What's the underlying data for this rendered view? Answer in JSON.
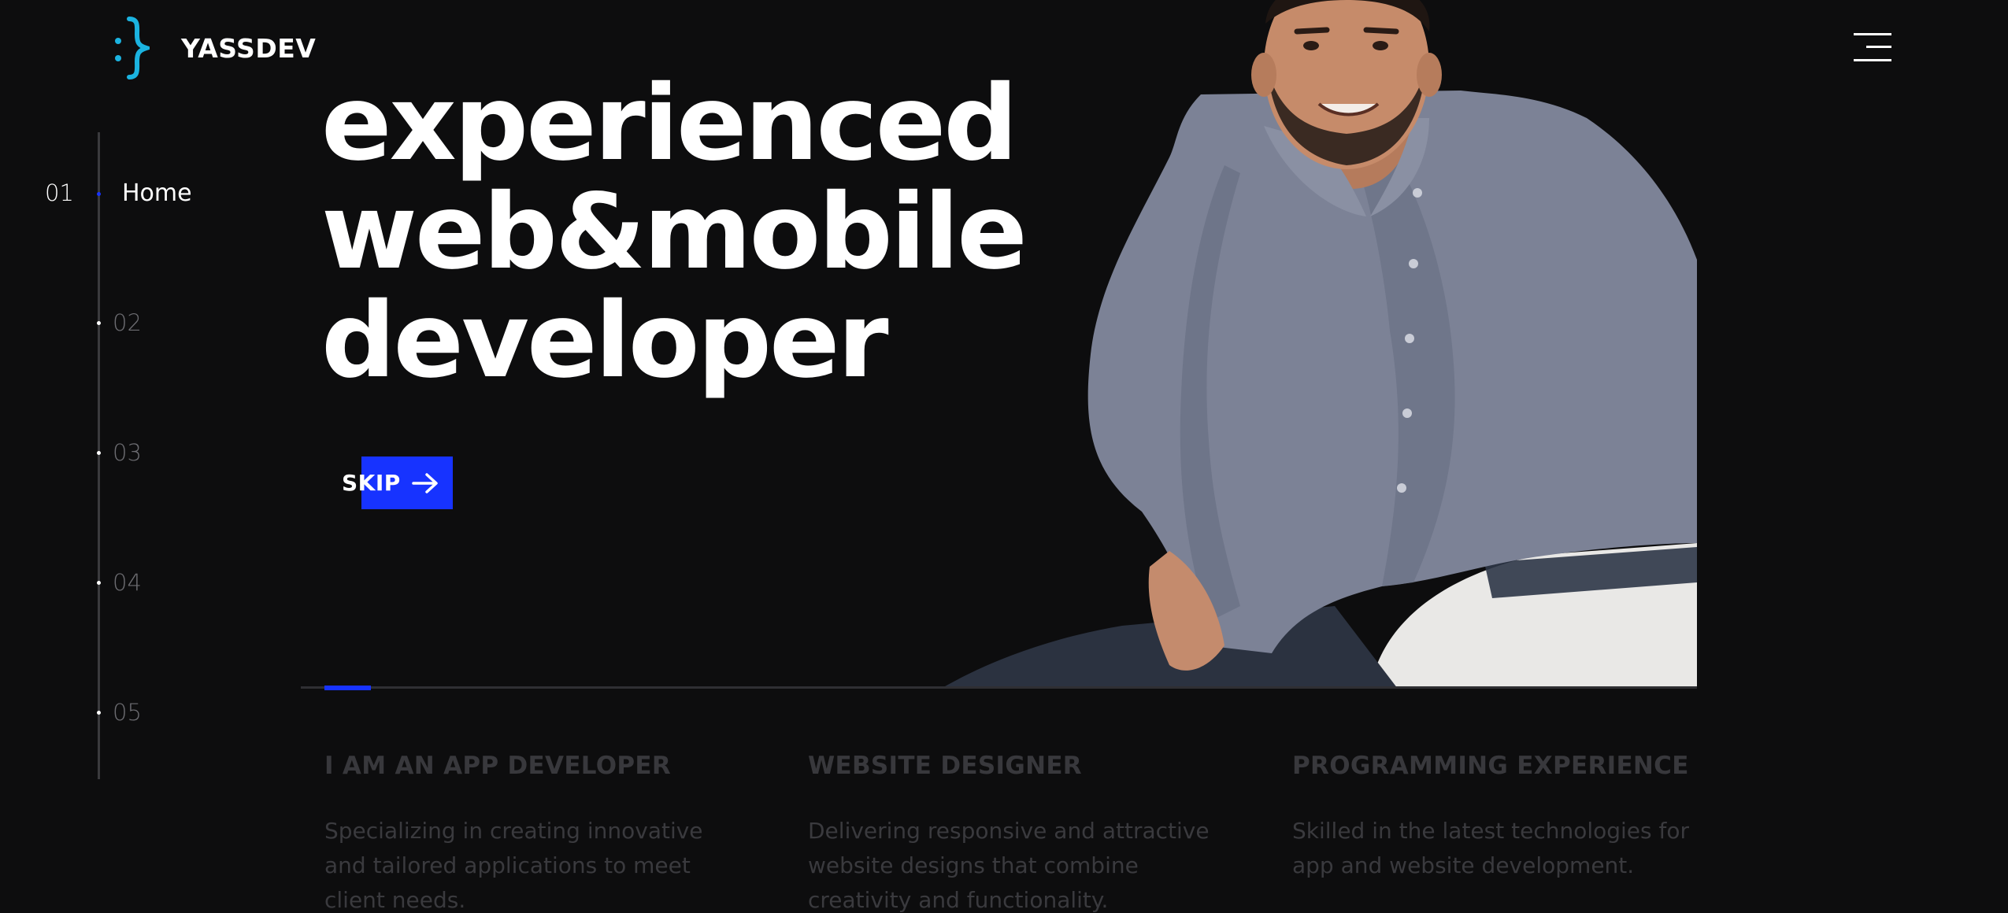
{
  "brand": {
    "name": "YASSDEV",
    "logo_icon": "colon-brace-logo",
    "accent": "#1bb3e0"
  },
  "header": {
    "menu_icon": "hamburger-menu-icon"
  },
  "side_nav": {
    "active": {
      "number": "01",
      "label": "Home"
    },
    "items": [
      {
        "number": "02"
      },
      {
        "number": "03"
      },
      {
        "number": "04"
      },
      {
        "number": "05"
      }
    ]
  },
  "hero": {
    "lines": [
      "experienced",
      "web&mobile",
      "developer"
    ],
    "skip_label": "SKIP",
    "skip_icon": "arrow-right-icon",
    "accent": "#1733ff",
    "progress": 0.02
  },
  "features": [
    {
      "title": "I AM AN APP DEVELOPER",
      "text": "Specializing in creating innovative and tailored applications to meet client needs."
    },
    {
      "title": "WEBSITE DESIGNER",
      "text": "Delivering responsive and attractive website designs that combine creativity and functionality."
    },
    {
      "title": "PROGRAMMING EXPERIENCE",
      "text": "Skilled in the latest technologies for app and website development."
    }
  ]
}
